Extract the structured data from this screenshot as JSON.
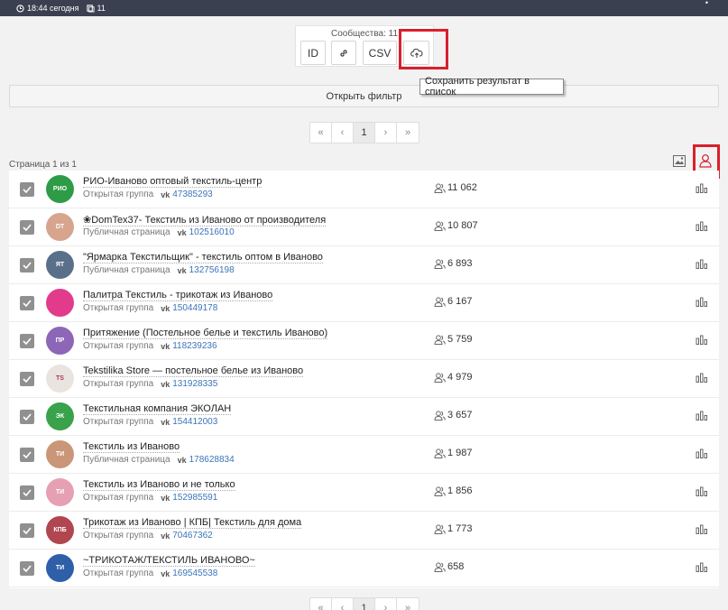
{
  "topbar": {
    "time": "18:44 сегодня",
    "count": "11"
  },
  "export": {
    "count_label": "Сообщества: 11",
    "id_label": "ID",
    "csv_label": "CSV"
  },
  "tooltip": {
    "save_to_list": "Сохранить результат в список"
  },
  "filter": {
    "label": "Открыть фильтр"
  },
  "pagination": {
    "first": "«",
    "prev": "‹",
    "current": "1",
    "next": "›",
    "last": "»"
  },
  "page_info": "Страница 1 из 1",
  "vk_label": "vk",
  "communities": [
    {
      "name": "РИО-Иваново оптовый текстиль-центр",
      "type": "Открытая группа",
      "id": "47385293",
      "members": "11 062",
      "avatar_text": "РИО",
      "avatar_color": "#2e9b47"
    },
    {
      "name": "❀DomTex37- Текстиль из Иваново от производителя",
      "type": "Публичная страница",
      "id": "102516010",
      "members": "10 807",
      "avatar_text": "DT",
      "avatar_color": "#d7a58e"
    },
    {
      "name": "\"Ярмарка Текстильщик\" - текстиль оптом в Иваново",
      "type": "Публичная страница",
      "id": "132756198",
      "members": "6 893",
      "avatar_text": "ЯТ",
      "avatar_color": "#5a6f8a"
    },
    {
      "name": "Палитра Текстиль - трикотаж из Иваново",
      "type": "Открытая группа",
      "id": "150449178",
      "members": "6 167",
      "avatar_text": "",
      "avatar_color": "#e23b8b"
    },
    {
      "name": "Притяжение (Постельное белье и текстиль Иваново)",
      "type": "Открытая группа",
      "id": "118239236",
      "members": "5 759",
      "avatar_text": "ПР",
      "avatar_color": "#8e66b8"
    },
    {
      "name": "Tekstilika Store — постельное белье из Иваново",
      "type": "Открытая группа",
      "id": "131928335",
      "members": "4 979",
      "avatar_text": "TS",
      "avatar_color": "#e9e4e0"
    },
    {
      "name": "Текстильная компания ЭКОЛАН",
      "type": "Открытая группа",
      "id": "154412003",
      "members": "3 657",
      "avatar_text": "ЭК",
      "avatar_color": "#39a24a"
    },
    {
      "name": "Текстиль из Иваново",
      "type": "Публичная страница",
      "id": "178628834",
      "members": "1 987",
      "avatar_text": "ТИ",
      "avatar_color": "#c99778"
    },
    {
      "name": "Текстиль из Иваново и не только",
      "type": "Открытая группа",
      "id": "152985591",
      "members": "1 856",
      "avatar_text": "ТИ",
      "avatar_color": "#e6a0b4"
    },
    {
      "name": "Трикотаж из Иваново | КПБ| Текстиль для дома",
      "type": "Открытая группа",
      "id": "70467362",
      "members": "1 773",
      "avatar_text": "КПБ",
      "avatar_color": "#b0464f"
    },
    {
      "name": "~ТРИКОТАЖ/ТЕКСТИЛЬ ИВАНОВО~",
      "type": "Открытая группа",
      "id": "169545538",
      "members": "658",
      "avatar_text": "ТИ",
      "avatar_color": "#2f5fa8"
    }
  ],
  "colors": {
    "highlight": "#d9202b",
    "link": "#3b74b8",
    "topbar": "#3a4050"
  }
}
